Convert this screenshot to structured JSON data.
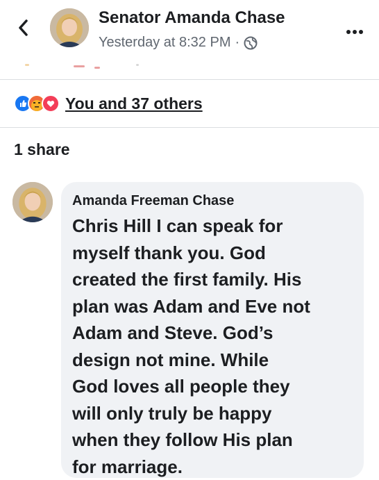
{
  "post": {
    "author": "Senator Amanda Chase",
    "timestamp": "Yesterday at 8:32 PM",
    "separator": "·",
    "privacy_icon": "globe-icon",
    "more_icon": "more-horizontal-icon",
    "back_icon": "chevron-left-icon"
  },
  "reactions": {
    "icons": [
      "like-icon",
      "angry-icon",
      "love-icon"
    ],
    "summary": "You and 37 others"
  },
  "shares": {
    "label": "1 share"
  },
  "comment": {
    "author": "Amanda Freeman Chase",
    "lines": [
      "Chris Hill I can speak for",
      "myself thank you.  God",
      "created the first family.  His",
      "plan was Adam and Eve not",
      "Adam and Steve.  God’s",
      "design not mine.  While",
      "God loves all people they",
      "will only truly be happy",
      "when they follow His plan",
      "for marriage."
    ]
  },
  "colors": {
    "text": "#1c1e21",
    "secondary_text": "#606770",
    "like_blue": "#1877f2",
    "angry_orange": "#f7b125",
    "love_red": "#f33e58",
    "bubble_bg": "#f0f2f5"
  }
}
